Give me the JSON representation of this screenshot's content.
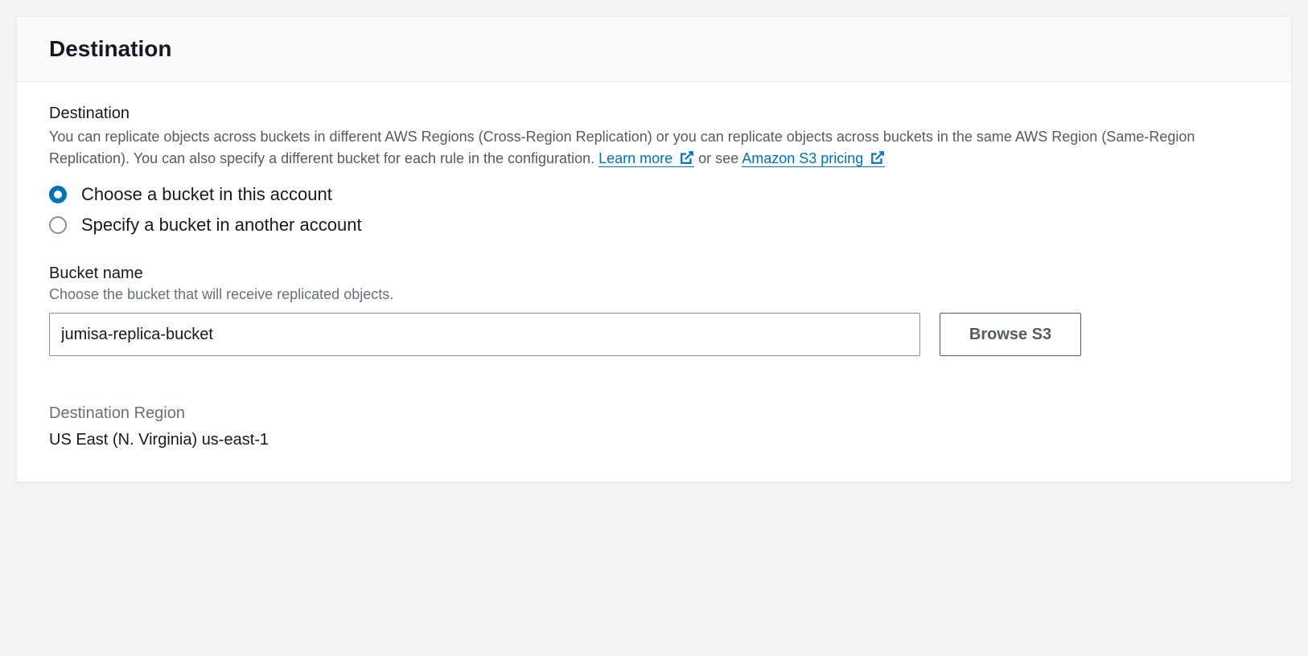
{
  "header": {
    "title": "Destination"
  },
  "destination": {
    "label": "Destination",
    "description_pre": "You can replicate objects across buckets in different AWS Regions (Cross-Region Replication) or you can replicate objects across buckets in the same AWS Region (Same-Region Replication). You can also specify a different bucket for each rule in the configuration. ",
    "learn_more": "Learn more ",
    "description_mid": " or see ",
    "pricing_link": "Amazon S3 pricing ",
    "radio_options": {
      "this_account": "Choose a bucket in this account",
      "another_account": "Specify a bucket in another account"
    }
  },
  "bucket": {
    "label": "Bucket name",
    "hint": "Choose the bucket that will receive replicated objects.",
    "value": "jumisa-replica-bucket",
    "browse_label": "Browse S3"
  },
  "region": {
    "label": "Destination Region",
    "value": "US East (N. Virginia) us-east-1"
  }
}
